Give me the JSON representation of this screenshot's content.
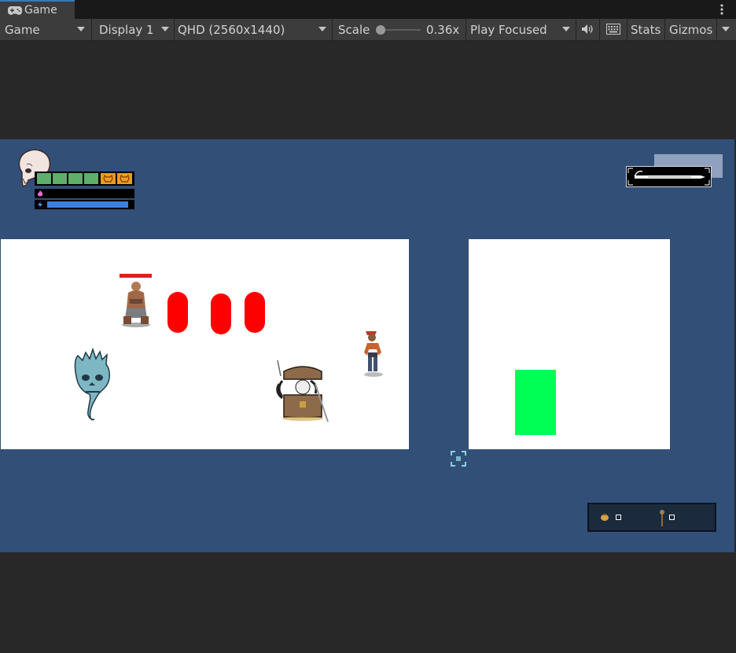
{
  "window": {
    "tab_title": "Game",
    "tab_icon": "gamepad-icon",
    "menu_icon": "kebab-menu-icon"
  },
  "toolbar": {
    "view_mode": "Game",
    "display": "Display 1",
    "resolution": "QHD (2560x1440)",
    "scale_label": "Scale",
    "scale_value": "0.36x",
    "scale_level": 0.0,
    "play_mode": "Play Focused",
    "mute_icon": "speaker-icon",
    "keyboard_icon": "keyboard-icon",
    "stats_label": "Stats",
    "gizmos_label": "Gizmos"
  },
  "game": {
    "background_color": "#324f78",
    "hud": {
      "portrait": "skull-icon",
      "health_slots": [
        "green",
        "green",
        "green",
        "green",
        "orange-beast",
        "orange-beast"
      ],
      "mana_level": 0.0,
      "energy_level": 0.96,
      "mana_icon": "flame-icon",
      "energy_icon": "lightning-icon",
      "energy_color": "#3d7fe0"
    },
    "weapon_icon": "sword-icon",
    "inventory": {
      "slots": [
        {
          "icon": "coin-pouch-icon"
        },
        {
          "icon": "staff-icon"
        }
      ]
    },
    "entities": [
      {
        "name": "brute-warrior"
      },
      {
        "name": "ghost-skull"
      },
      {
        "name": "mimic-chest"
      },
      {
        "name": "pirate-player"
      }
    ],
    "pills_color": "#ff0000",
    "marker_color": "#00ff55",
    "enemy_health_color": "#e02020"
  }
}
